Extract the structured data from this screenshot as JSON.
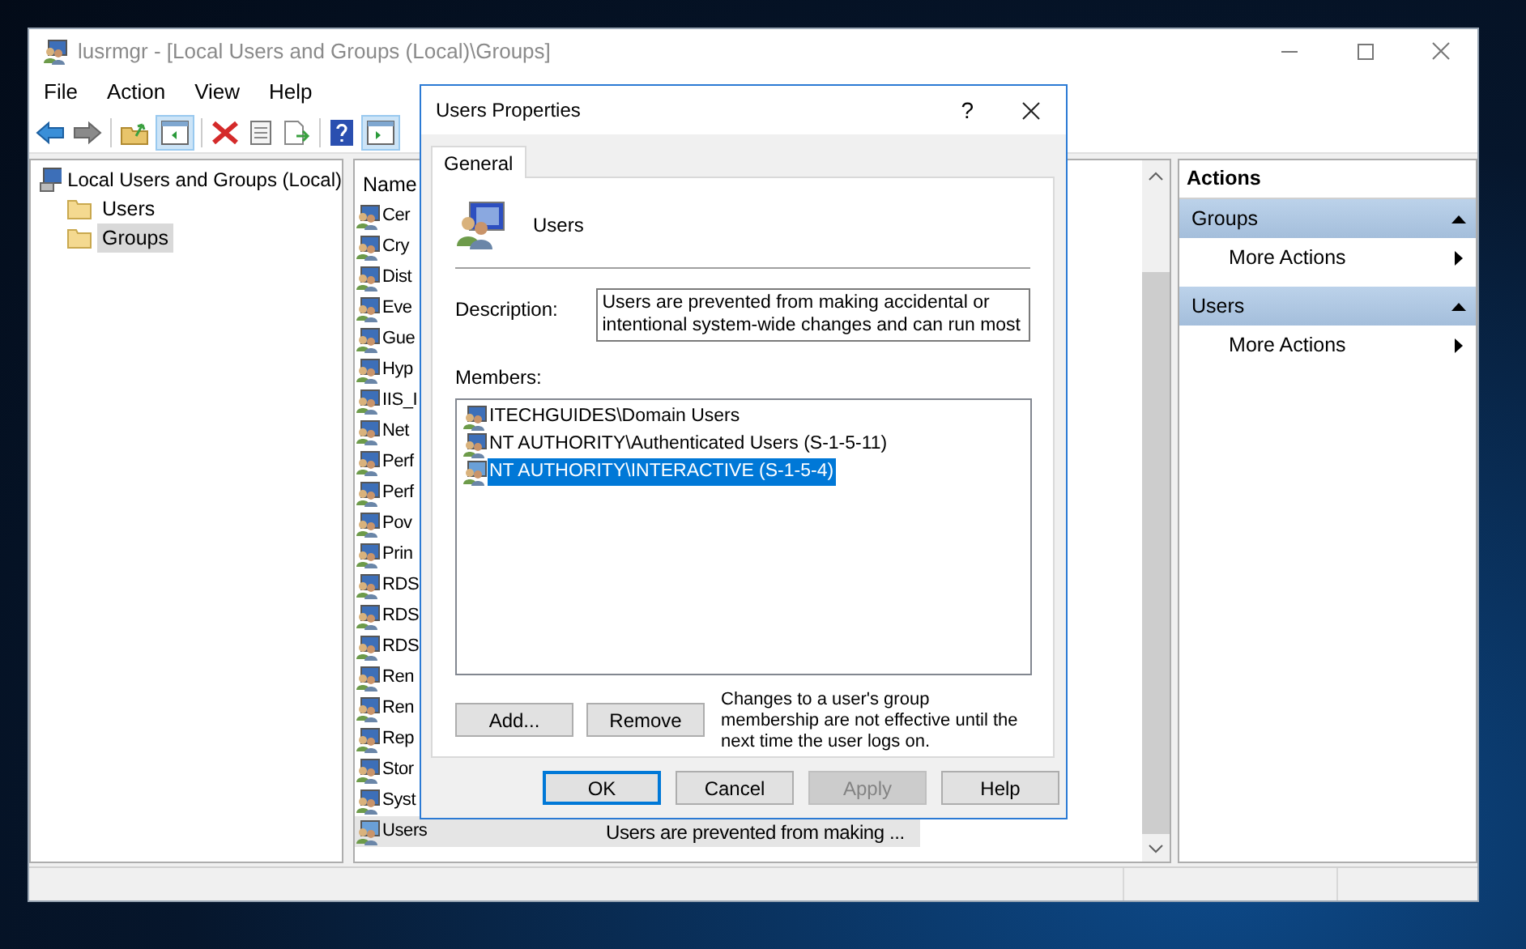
{
  "window": {
    "title": "lusrmgr - [Local Users and Groups (Local)\\Groups]"
  },
  "menu": [
    "File",
    "Action",
    "View",
    "Help"
  ],
  "tree": {
    "label": "Local Users and Groups (Local)",
    "children": [
      {
        "label": "Users",
        "selected": false
      },
      {
        "label": "Groups",
        "selected": true
      }
    ]
  },
  "list": {
    "columns": [
      "Name"
    ],
    "rows": [
      {
        "name": "Cer",
        "selected": false
      },
      {
        "name": "Cry",
        "selected": false
      },
      {
        "name": "Dist",
        "selected": false
      },
      {
        "name": "Eve",
        "selected": false
      },
      {
        "name": "Gue",
        "selected": false
      },
      {
        "name": "Hyp",
        "selected": false
      },
      {
        "name": "IIS_I",
        "selected": false
      },
      {
        "name": "Net",
        "selected": false
      },
      {
        "name": "Perf",
        "selected": false
      },
      {
        "name": "Perf",
        "selected": false
      },
      {
        "name": "Pov",
        "selected": false
      },
      {
        "name": "Prin",
        "selected": false
      },
      {
        "name": "RDS",
        "selected": false
      },
      {
        "name": "RDS",
        "selected": false
      },
      {
        "name": "RDS",
        "selected": false
      },
      {
        "name": "Ren",
        "selected": false
      },
      {
        "name": "Ren",
        "selected": false
      },
      {
        "name": "Rep",
        "selected": false
      },
      {
        "name": "Stor",
        "selected": false
      },
      {
        "name": "Syst",
        "selected": false
      },
      {
        "name": "Users",
        "description": "Users are prevented from making ...",
        "selected": true
      }
    ]
  },
  "actions": {
    "title": "Actions",
    "sections": [
      {
        "title": "Groups",
        "expanded": true,
        "items": [
          "More Actions"
        ]
      },
      {
        "title": "Users",
        "expanded": true,
        "items": [
          "More Actions"
        ]
      }
    ]
  },
  "dialog": {
    "title": "Users Properties",
    "help": "?",
    "tabs": [
      {
        "label": "General",
        "selected": true
      }
    ],
    "group_name": "Users",
    "description_label": "Description:",
    "description": "Users are prevented from making accidental or intentional system-wide changes and can run most",
    "members_label": "Members:",
    "members": [
      {
        "name": "ITECHGUIDES\\Domain Users",
        "selected": false
      },
      {
        "name": "NT AUTHORITY\\Authenticated Users (S-1-5-11)",
        "selected": false
      },
      {
        "name": "NT AUTHORITY\\INTERACTIVE (S-1-5-4)",
        "selected": true
      }
    ],
    "member_buttons": [
      "Add...",
      "Remove"
    ],
    "note": "Changes to a user's group membership are not effective until the next time the user logs on.",
    "buttons": [
      {
        "label": "OK",
        "default": true,
        "disabled": false
      },
      {
        "label": "Cancel",
        "default": false,
        "disabled": false
      },
      {
        "label": "Apply",
        "default": false,
        "disabled": true
      },
      {
        "label": "Help",
        "default": false,
        "disabled": false
      }
    ]
  }
}
